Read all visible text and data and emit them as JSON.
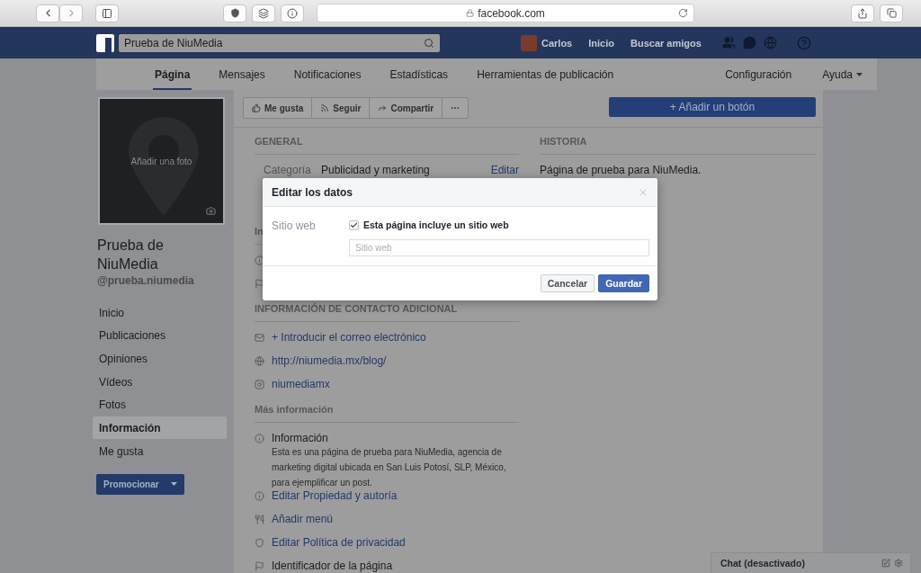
{
  "browser": {
    "url": "facebook.com"
  },
  "topbar": {
    "search": {
      "value": "Prueba de NiuMedia"
    },
    "user": "Carlos",
    "links": [
      "Inicio",
      "Buscar amigos"
    ]
  },
  "tabs": [
    {
      "label": "Página",
      "selected": true
    },
    {
      "label": "Mensajes",
      "selected": false
    },
    {
      "label": "Notificaciones",
      "selected": false
    },
    {
      "label": "Estadísticas",
      "selected": false
    },
    {
      "label": "Herramientas de publicación",
      "selected": false
    }
  ],
  "right_tabs": [
    {
      "label": "Configuración",
      "menu": false
    },
    {
      "label": "Ayuda",
      "menu": true
    }
  ],
  "profile": {
    "photo_label": "Añadir una foto",
    "name": "Prueba de NiuMedia",
    "handle": "@prueba.niumedia"
  },
  "nav": [
    {
      "label": "Inicio",
      "selected": false
    },
    {
      "label": "Publicaciones",
      "selected": false
    },
    {
      "label": "Opiniones",
      "selected": false
    },
    {
      "label": "Vídeos",
      "selected": false
    },
    {
      "label": "Fotos",
      "selected": false
    },
    {
      "label": "Información",
      "selected": true
    },
    {
      "label": "Me gusta",
      "selected": false
    }
  ],
  "promote_button": "Promocionar",
  "actions": [
    {
      "kind": "like",
      "label": "Me gusta"
    },
    {
      "kind": "follow",
      "label": "Seguir"
    },
    {
      "kind": "share",
      "label": "Compartir"
    },
    {
      "kind": "more",
      "label": "···"
    }
  ],
  "add_button": "+ Añadir un botón",
  "general": {
    "heading": "GENERAL",
    "rows": [
      {
        "label": "Categoría",
        "value": "Publicidad y marketing",
        "action": "Editar"
      }
    ]
  },
  "info_section": {
    "heading": "In",
    "rows": [
      {
        "kind": "info"
      },
      {
        "kind": "flag"
      }
    ]
  },
  "contact": {
    "heading": "INFORMACIÓN DE CONTACTO ADICIONAL",
    "items": [
      {
        "kind": "email",
        "text": "+ Introducir el correo electrónico"
      },
      {
        "kind": "web",
        "text": "http://niumedia.mx/blog/"
      },
      {
        "kind": "instagram",
        "text": "niumediamx"
      }
    ]
  },
  "more": {
    "heading": "Más información",
    "items": [
      {
        "kind": "info",
        "title": "Información",
        "text": "Esta es una página de prueba para NiuMedia, agencia de marketing digital ubicada en San Luis Potosí, SLP, México, para ejemplificar un post."
      },
      {
        "kind": "info",
        "link": "Editar Propiedad y autoría"
      },
      {
        "kind": "menu",
        "link": "Añadir menú"
      },
      {
        "kind": "privacy",
        "link": "Editar Política de privacidad"
      },
      {
        "kind": "flag",
        "title": "Identificador de la página"
      }
    ]
  },
  "story": {
    "heading": "HISTORIA",
    "text": "Página de prueba para NiuMedia."
  },
  "dialog": {
    "title": "Editar los datos",
    "field_label": "Sitio web",
    "checkbox": {
      "label": "Esta página incluye un sitio web",
      "checked": true
    },
    "input": {
      "placeholder": "Sitio web"
    },
    "buttons": [
      {
        "label": "Cancelar",
        "kind": "secondary"
      },
      {
        "label": "Guardar",
        "kind": "primary"
      }
    ]
  },
  "chat": {
    "label": "Chat (desactivado)"
  }
}
